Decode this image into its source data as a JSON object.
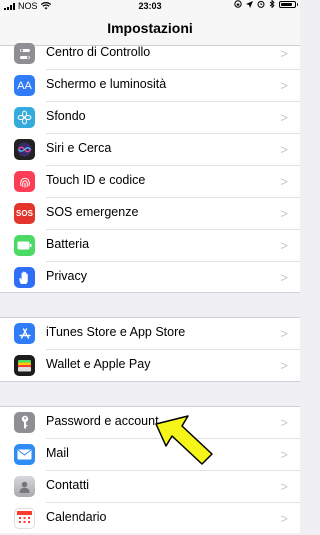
{
  "status_bar": {
    "carrier": "NOS",
    "time": "23:03"
  },
  "navbar": {
    "title": "Impostazioni"
  },
  "group1": [
    {
      "label": "Centro di Controllo",
      "icon": "control-center-icon",
      "color": "#8e8e93"
    },
    {
      "label": "Schermo e luminosità",
      "icon": "display-aa-icon",
      "color": "#2f7cf6",
      "glyph": "AA"
    },
    {
      "label": "Sfondo",
      "icon": "wallpaper-flower-icon",
      "color": "#35aadc"
    },
    {
      "label": "Siri e Cerca",
      "icon": "siri-icon",
      "color": "#222222"
    },
    {
      "label": "Touch ID e codice",
      "icon": "fingerprint-icon",
      "color": "#fc3d56"
    },
    {
      "label": "SOS emergenze",
      "icon": "sos-icon",
      "color": "#e3352c",
      "glyph": "SOS"
    },
    {
      "label": "Batteria",
      "icon": "battery-icon",
      "color": "#4cd964"
    },
    {
      "label": "Privacy",
      "icon": "privacy-hand-icon",
      "color": "#2f6ef6"
    }
  ],
  "group2": [
    {
      "label": "iTunes Store e App Store",
      "icon": "app-store-icon",
      "color": "#2f7cf6"
    },
    {
      "label": "Wallet e Apple Pay",
      "icon": "wallet-icon",
      "color": "#1c1c1e"
    }
  ],
  "group3": [
    {
      "label": "Password e account",
      "icon": "key-icon",
      "color": "#8e8e93"
    },
    {
      "label": "Mail",
      "icon": "mail-icon",
      "color": "#2f8cf6"
    },
    {
      "label": "Contatti",
      "icon": "contacts-icon",
      "color": "#b0b0b5"
    },
    {
      "label": "Calendario",
      "icon": "calendar-icon",
      "color": "#ffffff"
    }
  ],
  "annotation": {
    "color": "#f5f51a",
    "icon": "yellow-pointer-arrow"
  }
}
